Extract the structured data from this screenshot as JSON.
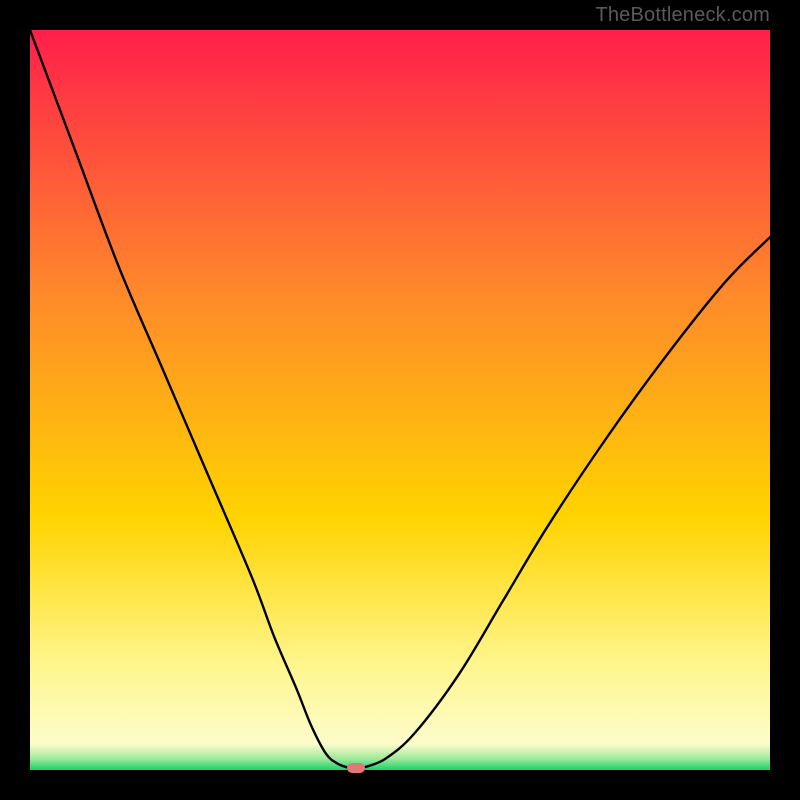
{
  "watermark": "TheBottleneck.com",
  "colors": {
    "top": "#ff1f4b",
    "mid_upper": "#ff8a2a",
    "mid": "#ffd400",
    "mid_lower": "#fff68f",
    "green": "#18d36a",
    "marker": "#e07878",
    "curve": "#000000",
    "bg": "#000000"
  },
  "chart_data": {
    "type": "line",
    "title": "",
    "xlabel": "",
    "ylabel": "",
    "xlim": [
      0,
      100
    ],
    "ylim": [
      0,
      100
    ],
    "annotations": [],
    "series": [
      {
        "name": "left-branch",
        "x": [
          0,
          6,
          12,
          18,
          24,
          30,
          33,
          36,
          38,
          40,
          41.5,
          43
        ],
        "values": [
          100,
          84,
          68,
          54,
          40,
          26,
          18,
          11,
          6,
          2.2,
          0.9,
          0.3
        ]
      },
      {
        "name": "right-branch",
        "x": [
          45,
          48,
          52,
          58,
          64,
          70,
          78,
          86,
          94,
          100
        ],
        "values": [
          0.3,
          1.5,
          5,
          13,
          23,
          33,
          45,
          56,
          66,
          72
        ]
      }
    ],
    "minimum_marker": {
      "x": 44,
      "y": 0.3
    },
    "gradient_stops": [
      {
        "offset": 0.0,
        "color": "#ff1f4b"
      },
      {
        "offset": 0.36,
        "color": "#ff8a2a"
      },
      {
        "offset": 0.66,
        "color": "#ffd400"
      },
      {
        "offset": 0.86,
        "color": "#fff68f"
      },
      {
        "offset": 0.965,
        "color": "#fdfccb"
      },
      {
        "offset": 0.985,
        "color": "#9fe89a"
      },
      {
        "offset": 1.0,
        "color": "#18d36a"
      }
    ]
  }
}
